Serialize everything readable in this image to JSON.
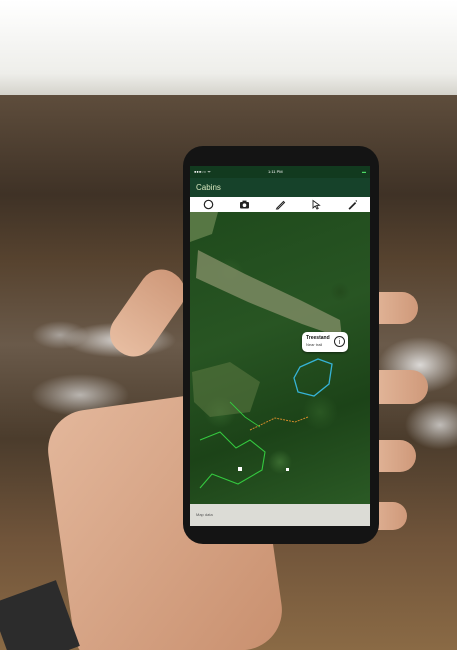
{
  "app": {
    "status_left": "●●●○○ ᯤ",
    "status_time": "1:11 PM",
    "status_right": "▬",
    "title": "Cabins",
    "toolbar_icons": [
      "circle-tool-icon",
      "camera-icon",
      "pencil-icon",
      "pointer-icon",
      "pen-icon"
    ],
    "callout_title": "Treestand",
    "callout_subtitle": "Near trail",
    "callout_info": "i",
    "bottom_text": "Map data"
  },
  "colors": {
    "app_bar": "#16422a",
    "polygon": "#36b3d6",
    "trail_orange": "#d08a2a",
    "trail_green": "#34c93f"
  }
}
